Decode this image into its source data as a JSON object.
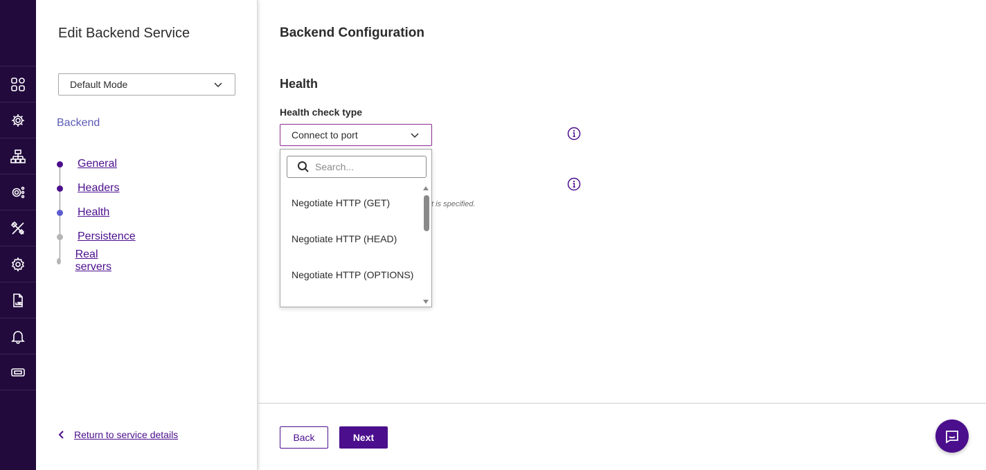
{
  "nav_rail": {
    "items": [
      {
        "icon": "dashboard-icon"
      },
      {
        "icon": "services-gear-icon"
      },
      {
        "icon": "network-icon"
      },
      {
        "icon": "cluster-settings-icon"
      },
      {
        "icon": "tools-icon"
      },
      {
        "icon": "settings-gear-icon"
      },
      {
        "icon": "log-file-icon"
      },
      {
        "icon": "notifications-bell-icon"
      },
      {
        "icon": "license-ticket-icon"
      }
    ]
  },
  "sidebar": {
    "title": "Edit Backend Service",
    "mode_select": {
      "value": "Default Mode"
    },
    "section_label": "Backend",
    "steps": [
      {
        "label": "General",
        "status": "done"
      },
      {
        "label": "Headers",
        "status": "done"
      },
      {
        "label": "Health",
        "status": "current"
      },
      {
        "label": "Persistence",
        "status": "todo"
      },
      {
        "label": "Real servers",
        "status": "todo"
      }
    ],
    "return_link": "Return to service details"
  },
  "main": {
    "title": "Backend Configuration",
    "section_title": "Health",
    "health_check": {
      "label": "Health check type",
      "value": "Connect to port"
    },
    "hint_fragment": "t is specified.",
    "dropdown": {
      "search_placeholder": "Search...",
      "options": [
        "Negotiate HTTP (GET)",
        "Negotiate HTTP (HEAD)",
        "Negotiate HTTP (OPTIONS)"
      ]
    }
  },
  "footer": {
    "back_label": "Back",
    "next_label": "Next"
  },
  "colors": {
    "rail_bg": "#220a3d",
    "accent": "#4b0e8c",
    "current_step": "#5b5bd0",
    "section_label": "#5b5bb8"
  }
}
